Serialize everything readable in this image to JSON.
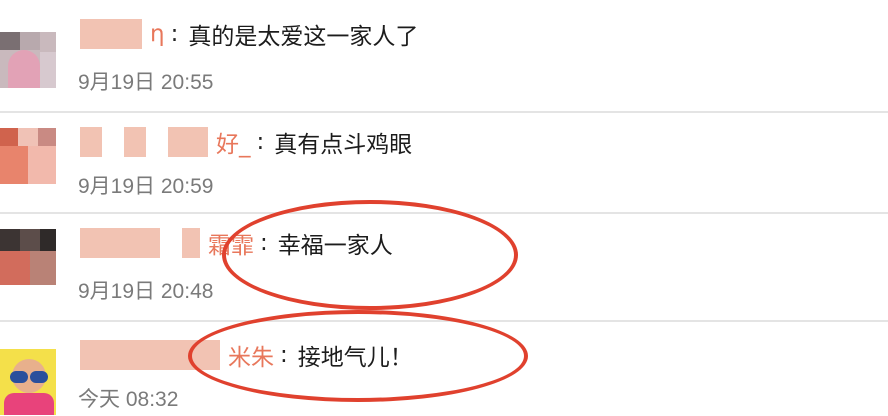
{
  "comments": [
    {
      "name_suffix": "η",
      "text": "真的是太爱这一家人了",
      "time": "9月19日 20:55"
    },
    {
      "name_suffix": "好_",
      "text": "真有点斗鸡眼",
      "time": "9月19日 20:59"
    },
    {
      "name_suffix": "霜霏",
      "text": "幸福一家人",
      "time": "9月19日 20:48"
    },
    {
      "name_suffix": "米朱",
      "text": "接地气儿！",
      "time": "今天 08:32"
    }
  ],
  "colors": {
    "username": "#e8775b",
    "highlight_ellipse": "#e0412e",
    "timestamp": "#7a7a7a",
    "divider": "#e4e4e4"
  }
}
